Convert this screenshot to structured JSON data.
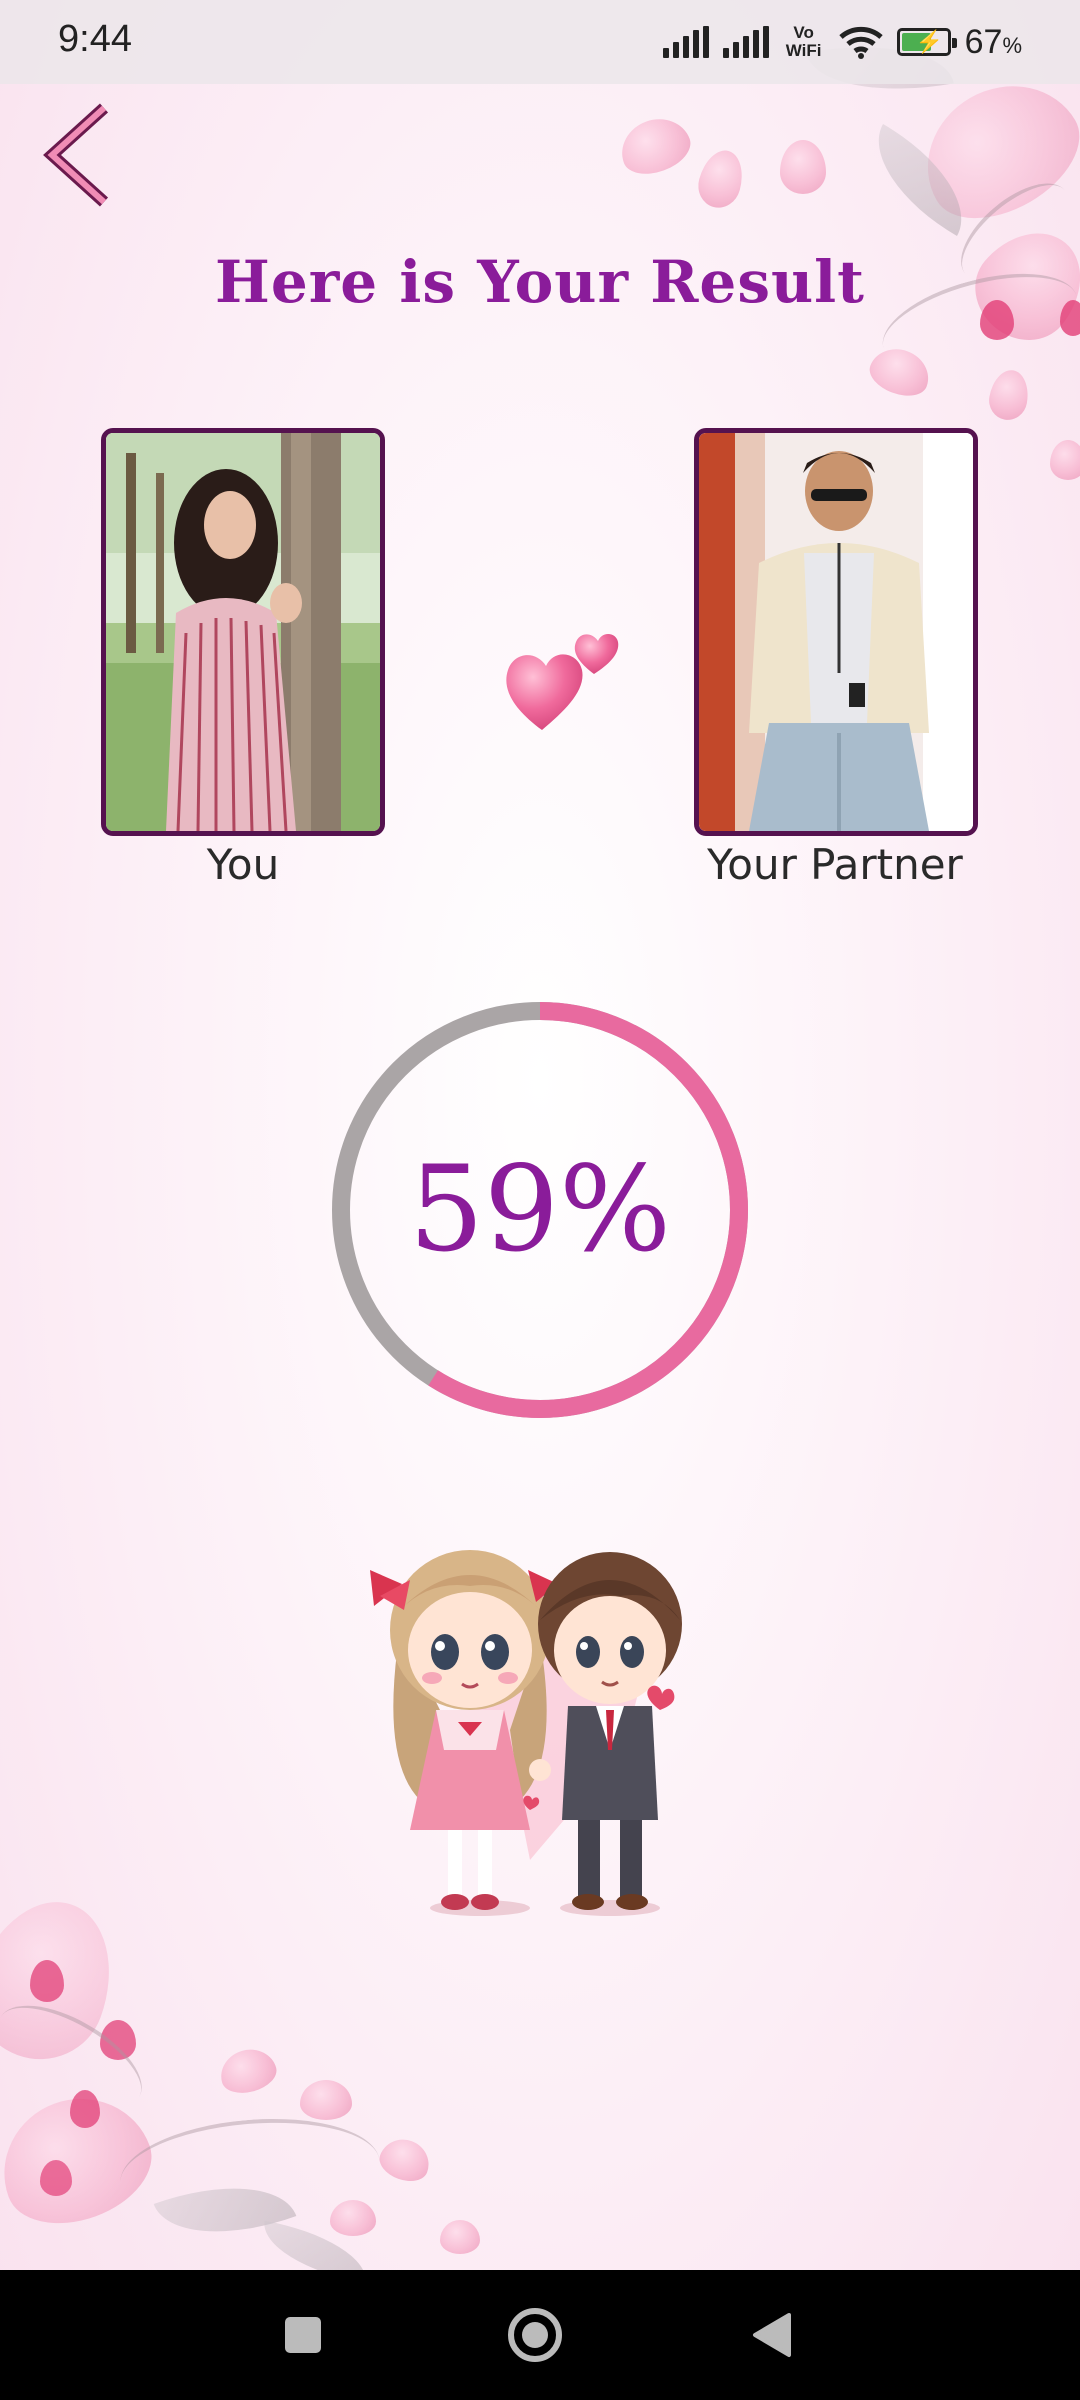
{
  "status_bar": {
    "time": "9:44",
    "vowifi_line1": "Vo",
    "vowifi_line2": "WiFi",
    "battery_percent": "67",
    "battery_percent_sign": "%",
    "battery_level": 0.67,
    "icons": [
      "signal-icon",
      "signal-icon",
      "vowifi-icon",
      "wifi-icon",
      "battery-charging-icon"
    ]
  },
  "header": {
    "back_icon": "chevron-left-icon",
    "title": "Here is Your Result"
  },
  "profiles": {
    "you_label": "You",
    "partner_label": "Your Partner",
    "heart_icon": "hearts-icon"
  },
  "result": {
    "percent": 59,
    "percent_text": "59%",
    "ring_color": "#e86a9f",
    "track_color": "#aaa5a6",
    "text_color": "#8a1c9a"
  },
  "nav_bar": {
    "icons": [
      "recents-square-icon",
      "home-circle-icon",
      "back-triangle-icon"
    ]
  },
  "colors": {
    "accent": "#8a1c9a",
    "frame": "#55124f",
    "pink": "#e86a9f"
  }
}
